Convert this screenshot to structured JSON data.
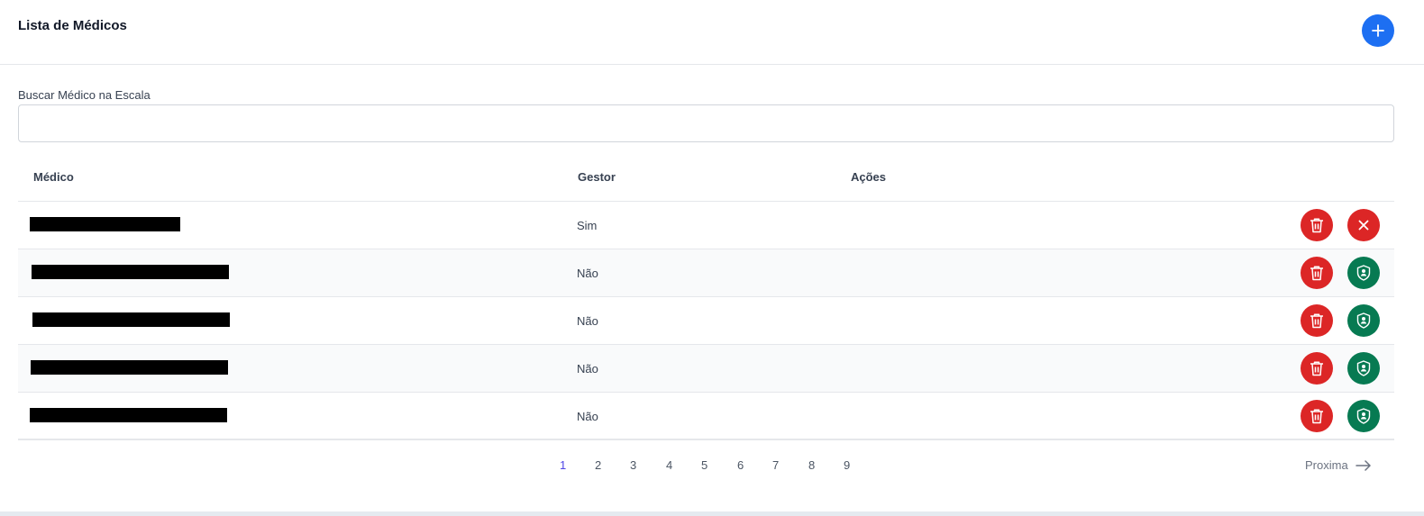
{
  "header": {
    "title": "Lista de Médicos"
  },
  "search": {
    "label": "Buscar Médico na Escala",
    "value": "",
    "placeholder": ""
  },
  "table": {
    "columns": [
      "Médico",
      "Gestor",
      "Ações"
    ],
    "rows": [
      {
        "name": "",
        "gestor": "Sim",
        "second_action": "remove"
      },
      {
        "name": "",
        "gestor": "Não",
        "second_action": "make-manager"
      },
      {
        "name": "",
        "gestor": "Não",
        "second_action": "make-manager"
      },
      {
        "name": "",
        "gestor": "Não",
        "second_action": "make-manager"
      },
      {
        "name": "",
        "gestor": "Não",
        "second_action": "make-manager"
      }
    ]
  },
  "pagination": {
    "pages": [
      "1",
      "2",
      "3",
      "4",
      "5",
      "6",
      "7",
      "8",
      "9"
    ],
    "current": "1",
    "next_label": "Proxima"
  },
  "colors": {
    "primary": "#1d6ff2",
    "danger": "#dc2626",
    "success": "#077a52",
    "active_page": "#4f46e5"
  },
  "icons": {
    "add": "plus-icon",
    "delete": "trash-icon",
    "remove": "close-icon",
    "manager": "shield-user-icon",
    "next": "arrow-right-icon"
  }
}
